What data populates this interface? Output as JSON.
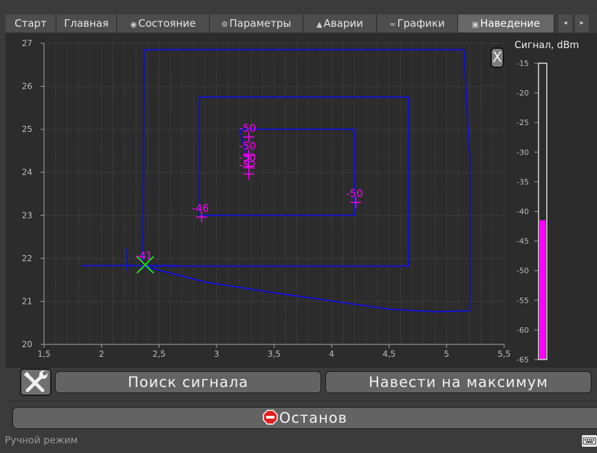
{
  "tabs": [
    {
      "label": "Старт",
      "icon": ""
    },
    {
      "label": "Главная",
      "icon": ""
    },
    {
      "label": "Состояние",
      "icon": "eye-icon"
    },
    {
      "label": "Параметры",
      "icon": "gears-icon"
    },
    {
      "label": "Аварии",
      "icon": "warning-icon"
    },
    {
      "label": "Графики",
      "icon": "wave-icon"
    },
    {
      "label": "Наведение",
      "icon": "square-icon",
      "active": true
    }
  ],
  "close_label": "X",
  "signal": {
    "title": "Сигнал, dBm",
    "ticks": [
      -15,
      -20,
      -25,
      -30,
      -35,
      -40,
      -45,
      -50,
      -55,
      -60,
      -65
    ],
    "range": [
      -65,
      -15
    ],
    "level": -41.5,
    "fill_color": "#ff00ff"
  },
  "chart_data": {
    "type": "line",
    "xlim": [
      1.5,
      5.5
    ],
    "ylim": [
      20,
      27
    ],
    "xticks": [
      "1,5",
      "2",
      "2,5",
      "3",
      "3,5",
      "4",
      "4,5",
      "5",
      "5,5"
    ],
    "yticks": [
      "20",
      "21",
      "22",
      "23",
      "24",
      "25",
      "26",
      "27"
    ],
    "grid": true,
    "track_color": "#1010d8",
    "track": [
      [
        2.36,
        21.9
      ],
      [
        2.37,
        26.85
      ],
      [
        5.15,
        26.85
      ],
      [
        5.2,
        24.4
      ],
      [
        5.2,
        20.78
      ],
      [
        4.9,
        20.76
      ],
      [
        4.5,
        20.82
      ],
      [
        3.5,
        21.2
      ],
      [
        2.9,
        21.45
      ],
      [
        2.36,
        21.82
      ],
      [
        4.67,
        21.82
      ],
      [
        4.67,
        25.75
      ],
      [
        2.85,
        25.75
      ],
      [
        2.85,
        23.0
      ],
      [
        4.2,
        23.0
      ],
      [
        4.2,
        25.0
      ],
      [
        3.2,
        25.0
      ],
      [
        3.28,
        24.2
      ]
    ],
    "crosshair_line": [
      [
        1.82,
        21.83
      ],
      [
        2.66,
        21.83
      ]
    ],
    "measurements": [
      {
        "x": 3.28,
        "y": 24.82,
        "value": "-50"
      },
      {
        "x": 3.28,
        "y": 24.4,
        "value": "-50"
      },
      {
        "x": 3.28,
        "y": 24.14,
        "value": "-50"
      },
      {
        "x": 3.28,
        "y": 23.96,
        "value": "-52"
      },
      {
        "x": 2.87,
        "y": 22.96,
        "value": "-46"
      },
      {
        "x": 4.21,
        "y": 23.3,
        "value": "-50"
      },
      {
        "x": 2.38,
        "y": 21.85,
        "value": "-41"
      }
    ],
    "measurement_color": "#ff00ff",
    "current_position": {
      "x": 2.38,
      "y": 21.85,
      "color": "#22dd22"
    },
    "cursor": {
      "x": 2.24,
      "y": 21.85
    }
  },
  "buttons": {
    "search": "Поиск сигнала",
    "point_max": "Навести на максимум",
    "stop": "Останов"
  },
  "status_text": "Ручной режим"
}
